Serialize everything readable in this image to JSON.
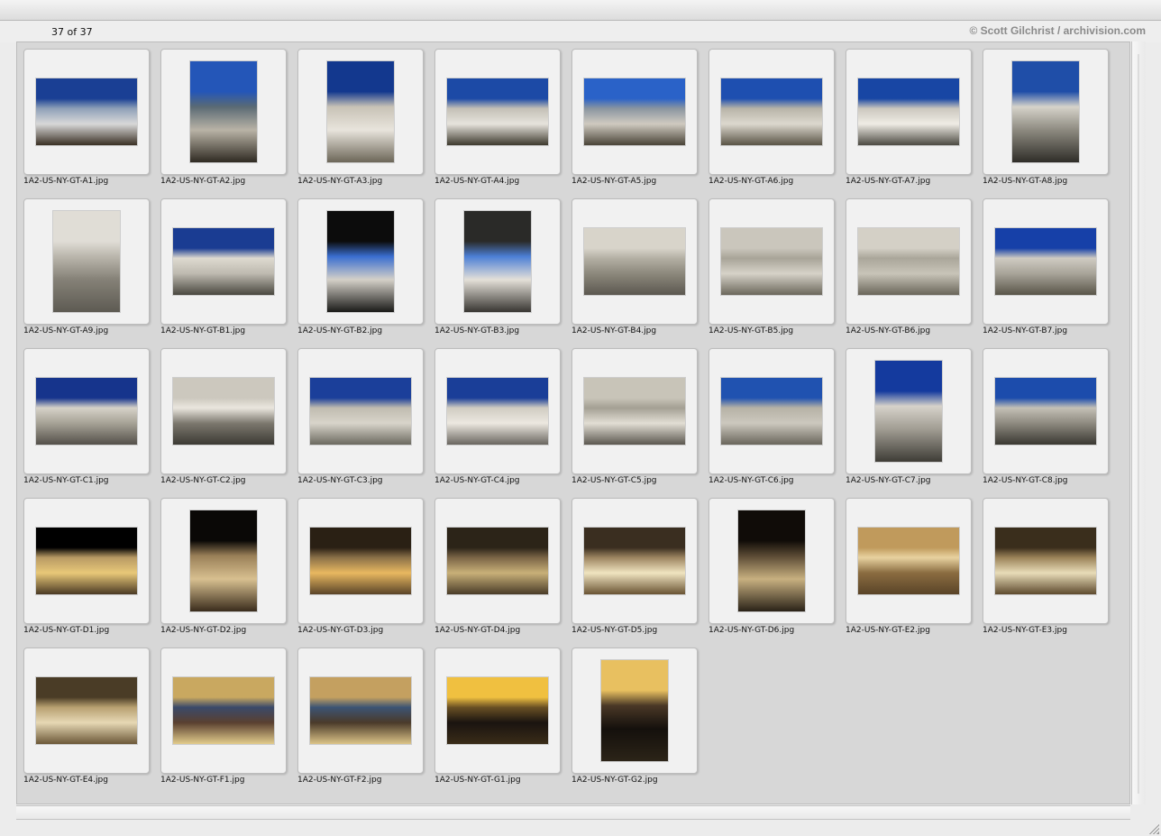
{
  "window": {
    "count_label": "37 of 37",
    "credit": "© Scott Gilchrist / archivision.com"
  },
  "thumbnails": [
    {
      "filename": "1A2-US-NY-GT-A1.jpg",
      "orientation": "landscape",
      "colors": [
        "#1a3f94",
        "#8ea0b8",
        "#d8d8d8",
        "#3a3024"
      ]
    },
    {
      "filename": "1A2-US-NY-GT-A2.jpg",
      "orientation": "portrait",
      "colors": [
        "#2456b8",
        "#5a6a74",
        "#b9b3a6",
        "#2f2a22"
      ]
    },
    {
      "filename": "1A2-US-NY-GT-A3.jpg",
      "orientation": "portrait",
      "colors": [
        "#13388e",
        "#c8c2b6",
        "#e8e4dc",
        "#6c6658"
      ]
    },
    {
      "filename": "1A2-US-NY-GT-A4.jpg",
      "orientation": "landscape",
      "colors": [
        "#1c4aa6",
        "#c4c0b6",
        "#e6e3dc",
        "#3e3a2e"
      ]
    },
    {
      "filename": "1A2-US-NY-GT-A5.jpg",
      "orientation": "landscape",
      "colors": [
        "#2a62c8",
        "#8a95a0",
        "#cfcac0",
        "#4a4438"
      ]
    },
    {
      "filename": "1A2-US-NY-GT-A6.jpg",
      "orientation": "landscape",
      "colors": [
        "#1e4fb0",
        "#b8b4a8",
        "#dcd8ce",
        "#5a5446"
      ]
    },
    {
      "filename": "1A2-US-NY-GT-A7.jpg",
      "orientation": "landscape",
      "colors": [
        "#1846a4",
        "#cbc7be",
        "#efece5",
        "#4c4a42"
      ]
    },
    {
      "filename": "1A2-US-NY-GT-A8.jpg",
      "orientation": "portrait",
      "colors": [
        "#1f4ea8",
        "#d6d3ca",
        "#8d8a80",
        "#2f2d28"
      ]
    },
    {
      "filename": "1A2-US-NY-GT-A9.jpg",
      "orientation": "portrait",
      "colors": [
        "#e0ddd6",
        "#bab6ac",
        "#858177",
        "#5d5a52"
      ]
    },
    {
      "filename": "1A2-US-NY-GT-B1.jpg",
      "orientation": "landscape",
      "colors": [
        "#1a3c92",
        "#dedad0",
        "#bebab0",
        "#4a4840"
      ]
    },
    {
      "filename": "1A2-US-NY-GT-B2.jpg",
      "orientation": "portrait",
      "colors": [
        "#0c0c0c",
        "#3a6ed0",
        "#d4d0c8",
        "#1a1a18"
      ]
    },
    {
      "filename": "1A2-US-NY-GT-B3.jpg",
      "orientation": "portrait",
      "colors": [
        "#2a2a28",
        "#4c7fd6",
        "#e4e0d8",
        "#383632"
      ]
    },
    {
      "filename": "1A2-US-NY-GT-B4.jpg",
      "orientation": "landscape",
      "colors": [
        "#d8d4ca",
        "#b4b0a4",
        "#8c887c",
        "#5c5850"
      ]
    },
    {
      "filename": "1A2-US-NY-GT-B5.jpg",
      "orientation": "landscape",
      "colors": [
        "#cac6bc",
        "#a8a498",
        "#d6d2c8",
        "#6c685c"
      ]
    },
    {
      "filename": "1A2-US-NY-GT-B6.jpg",
      "orientation": "landscape",
      "colors": [
        "#d4d0c6",
        "#aaa69a",
        "#c8c4b8",
        "#6a665a"
      ]
    },
    {
      "filename": "1A2-US-NY-GT-B7.jpg",
      "orientation": "landscape",
      "colors": [
        "#1640a8",
        "#cfcbc2",
        "#a8a499",
        "#595549"
      ]
    },
    {
      "filename": "1A2-US-NY-GT-C1.jpg",
      "orientation": "landscape",
      "colors": [
        "#16348c",
        "#d6d2c8",
        "#a6a296",
        "#54504a"
      ]
    },
    {
      "filename": "1A2-US-NY-GT-C2.jpg",
      "orientation": "landscape",
      "colors": [
        "#ccc8be",
        "#eae6de",
        "#7c786e",
        "#3c3a34"
      ]
    },
    {
      "filename": "1A2-US-NY-GT-C3.jpg",
      "orientation": "landscape",
      "colors": [
        "#1b3f9a",
        "#c0bcb0",
        "#d8d4ca",
        "#6c6a60"
      ]
    },
    {
      "filename": "1A2-US-NY-GT-C4.jpg",
      "orientation": "landscape",
      "colors": [
        "#1a3e98",
        "#d0ccc2",
        "#ece8e0",
        "#6a6660"
      ]
    },
    {
      "filename": "1A2-US-NY-GT-C5.jpg",
      "orientation": "landscape",
      "colors": [
        "#c8c4b8",
        "#a4a094",
        "#e2ded4",
        "#5c5850"
      ]
    },
    {
      "filename": "1A2-US-NY-GT-C6.jpg",
      "orientation": "landscape",
      "colors": [
        "#2052b0",
        "#b6b2a6",
        "#ccc8be",
        "#6a665c"
      ]
    },
    {
      "filename": "1A2-US-NY-GT-C7.jpg",
      "orientation": "portrait",
      "colors": [
        "#143a9e",
        "#d6d2ca",
        "#a09c92",
        "#3e3c36"
      ]
    },
    {
      "filename": "1A2-US-NY-GT-C8.jpg",
      "orientation": "landscape",
      "colors": [
        "#1c4cac",
        "#c4c0b6",
        "#8e8a80",
        "#3a3832"
      ]
    },
    {
      "filename": "1A2-US-NY-GT-D1.jpg",
      "orientation": "landscape",
      "colors": [
        "#000000",
        "#b89a64",
        "#e8c878",
        "#4a3a24"
      ]
    },
    {
      "filename": "1A2-US-NY-GT-D2.jpg",
      "orientation": "portrait",
      "colors": [
        "#0a0806",
        "#9a8058",
        "#d8c090",
        "#3a2c1c"
      ]
    },
    {
      "filename": "1A2-US-NY-GT-D3.jpg",
      "orientation": "landscape",
      "colors": [
        "#2a2014",
        "#8a7048",
        "#e8b860",
        "#5a4428"
      ]
    },
    {
      "filename": "1A2-US-NY-GT-D4.jpg",
      "orientation": "landscape",
      "colors": [
        "#2c2418",
        "#7a6446",
        "#c8b078",
        "#4a3c28"
      ]
    },
    {
      "filename": "1A2-US-NY-GT-D5.jpg",
      "orientation": "landscape",
      "colors": [
        "#3a2e20",
        "#9c8460",
        "#f0e4c0",
        "#6a5434"
      ]
    },
    {
      "filename": "1A2-US-NY-GT-D6.jpg",
      "orientation": "portrait",
      "colors": [
        "#100c08",
        "#5a4a34",
        "#c8b080",
        "#2a2218"
      ]
    },
    {
      "filename": "1A2-US-NY-GT-E2.jpg",
      "orientation": "landscape",
      "colors": [
        "#c09a5c",
        "#e8d2a0",
        "#8a6c40",
        "#5a4428"
      ]
    },
    {
      "filename": "1A2-US-NY-GT-E3.jpg",
      "orientation": "landscape",
      "colors": [
        "#3a2e1c",
        "#9a8258",
        "#e8dcb8",
        "#5e4a2e"
      ]
    },
    {
      "filename": "1A2-US-NY-GT-E4.jpg",
      "orientation": "landscape",
      "colors": [
        "#4a3c26",
        "#b8a070",
        "#e6d8b4",
        "#6c5838"
      ]
    },
    {
      "filename": "1A2-US-NY-GT-F1.jpg",
      "orientation": "landscape",
      "colors": [
        "#c9a860",
        "#3a4a6a",
        "#5a4030",
        "#e2cc8c"
      ]
    },
    {
      "filename": "1A2-US-NY-GT-F2.jpg",
      "orientation": "landscape",
      "colors": [
        "#c4a060",
        "#3c5474",
        "#4a3a2a",
        "#dcc488"
      ]
    },
    {
      "filename": "1A2-US-NY-GT-G1.jpg",
      "orientation": "landscape",
      "colors": [
        "#f0c040",
        "#6a5024",
        "#1a1410",
        "#3a2c18"
      ]
    },
    {
      "filename": "1A2-US-NY-GT-G2.jpg",
      "orientation": "portrait",
      "colors": [
        "#e8c060",
        "#4a3826",
        "#14100c",
        "#2c2418"
      ]
    }
  ]
}
